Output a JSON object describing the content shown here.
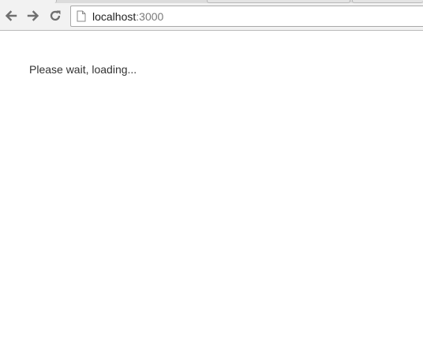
{
  "browser": {
    "address_bar": {
      "host": "localhost",
      "port": ":3000"
    },
    "icons": {
      "back": "arrow-left-icon",
      "forward": "arrow-right-icon",
      "reload": "reload-icon",
      "page": "page-document-icon"
    }
  },
  "page": {
    "loading_message": "Please wait, loading..."
  }
}
